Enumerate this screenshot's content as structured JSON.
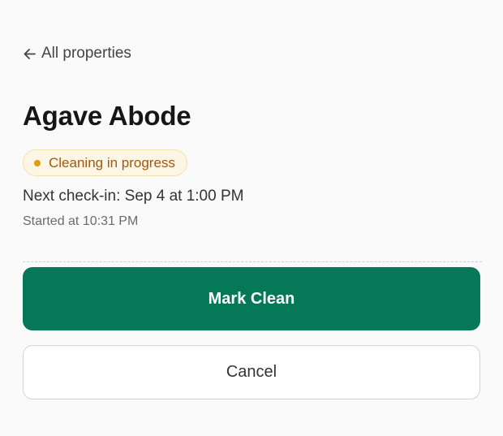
{
  "nav": {
    "back_label": "All properties",
    "back_icon": "arrow-left-icon"
  },
  "property": {
    "name": "Agave Abode"
  },
  "status": {
    "label": "Cleaning in progress",
    "dot_color": "#e29b12",
    "bg_color": "#fef6e4",
    "text_color": "#a2580e"
  },
  "details": {
    "next_checkin": "Next check-in: Sep 4 at 1:00 PM",
    "started": "Started at 10:31 PM"
  },
  "actions": {
    "primary_label": "Mark Clean",
    "primary_color": "#057857",
    "secondary_label": "Cancel"
  }
}
